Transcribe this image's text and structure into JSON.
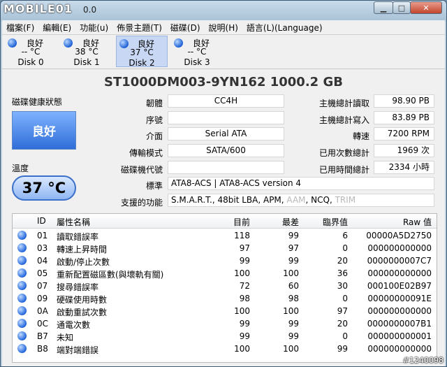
{
  "app": {
    "logo": "MOBILE01",
    "title_partial": "0.0"
  },
  "menu": [
    {
      "label": "檔案(F)"
    },
    {
      "label": "編輯(E)"
    },
    {
      "label": "功能(u)"
    },
    {
      "label": "佈景主題(T)"
    },
    {
      "label": "磁碟(D)"
    },
    {
      "label": "說明(H)"
    },
    {
      "label": "語言(L)(Language)"
    }
  ],
  "disks": [
    {
      "status": "良好",
      "temp": "-- °C",
      "name": "Disk 0"
    },
    {
      "status": "良好",
      "temp": "38 °C",
      "name": "Disk 1"
    },
    {
      "status": "良好",
      "temp": "37 °C",
      "name": "Disk 2"
    },
    {
      "status": "良好",
      "temp": "-- °C",
      "name": "Disk 3"
    }
  ],
  "model": "ST1000DM003-9YN162  1000.2 GB",
  "health": {
    "label": "磁碟健康狀態",
    "status": "良好"
  },
  "temperature": {
    "label": "溫度",
    "value": "37 °C"
  },
  "info": {
    "firmware": {
      "label": "韌體",
      "value": "CC4H"
    },
    "serial": {
      "label": "序號",
      "value": ""
    },
    "interface": {
      "label": "介面",
      "value": "Serial ATA"
    },
    "transfer": {
      "label": "傳輸模式",
      "value": "SATA/600"
    },
    "drive_letter": {
      "label": "磁碟機代號",
      "value": ""
    },
    "standard": {
      "label": "標準",
      "value": "ATA8-ACS | ATA8-ACS version 4"
    },
    "features": {
      "label": "支援的功能",
      "enabled": "S.M.A.R.T., 48bit LBA, APM, ",
      "aam": "AAM",
      "ncq": ", NCQ, ",
      "trim": "TRIM"
    },
    "host_reads": {
      "label": "主機總計讀取",
      "value": "98.90 PB"
    },
    "host_writes": {
      "label": "主機總計寫入",
      "value": "83.89 PB"
    },
    "rotation": {
      "label": "轉速",
      "value": "7200 RPM"
    },
    "power_count": {
      "label": "已用次數總計",
      "value": "1969 次"
    },
    "power_hours": {
      "label": "已用時間總計",
      "value": "2334 小時"
    }
  },
  "smart": {
    "headers": {
      "id": "ID",
      "name": "屬性名稱",
      "current": "目前",
      "worst": "最差",
      "threshold": "臨界值",
      "raw": "Raw 值"
    },
    "rows": [
      {
        "id": "01",
        "name": "讀取錯誤率",
        "current": "118",
        "worst": "99",
        "threshold": "6",
        "raw": "00000A5D2750"
      },
      {
        "id": "03",
        "name": "轉速上昇時間",
        "current": "97",
        "worst": "97",
        "threshold": "0",
        "raw": "000000000000"
      },
      {
        "id": "04",
        "name": "啟動/停止次數",
        "current": "99",
        "worst": "99",
        "threshold": "20",
        "raw": "0000000007C7"
      },
      {
        "id": "05",
        "name": "重新配置磁區數(與壞軌有關)",
        "current": "100",
        "worst": "100",
        "threshold": "36",
        "raw": "000000000000"
      },
      {
        "id": "07",
        "name": "搜尋錯誤率",
        "current": "72",
        "worst": "60",
        "threshold": "30",
        "raw": "000100E02B97"
      },
      {
        "id": "09",
        "name": "硬碟使用時數",
        "current": "98",
        "worst": "98",
        "threshold": "0",
        "raw": "00000000091E"
      },
      {
        "id": "0A",
        "name": "啟動重試次數",
        "current": "100",
        "worst": "100",
        "threshold": "97",
        "raw": "000000000000"
      },
      {
        "id": "0C",
        "name": "通電次數",
        "current": "99",
        "worst": "99",
        "threshold": "20",
        "raw": "0000000007B1"
      },
      {
        "id": "B7",
        "name": "未知",
        "current": "99",
        "worst": "99",
        "threshold": "0",
        "raw": "000000000001"
      },
      {
        "id": "B8",
        "name": "端對端錯誤",
        "current": "100",
        "worst": "100",
        "threshold": "99",
        "raw": "000000000000"
      }
    ]
  },
  "watermark": "#1240098"
}
